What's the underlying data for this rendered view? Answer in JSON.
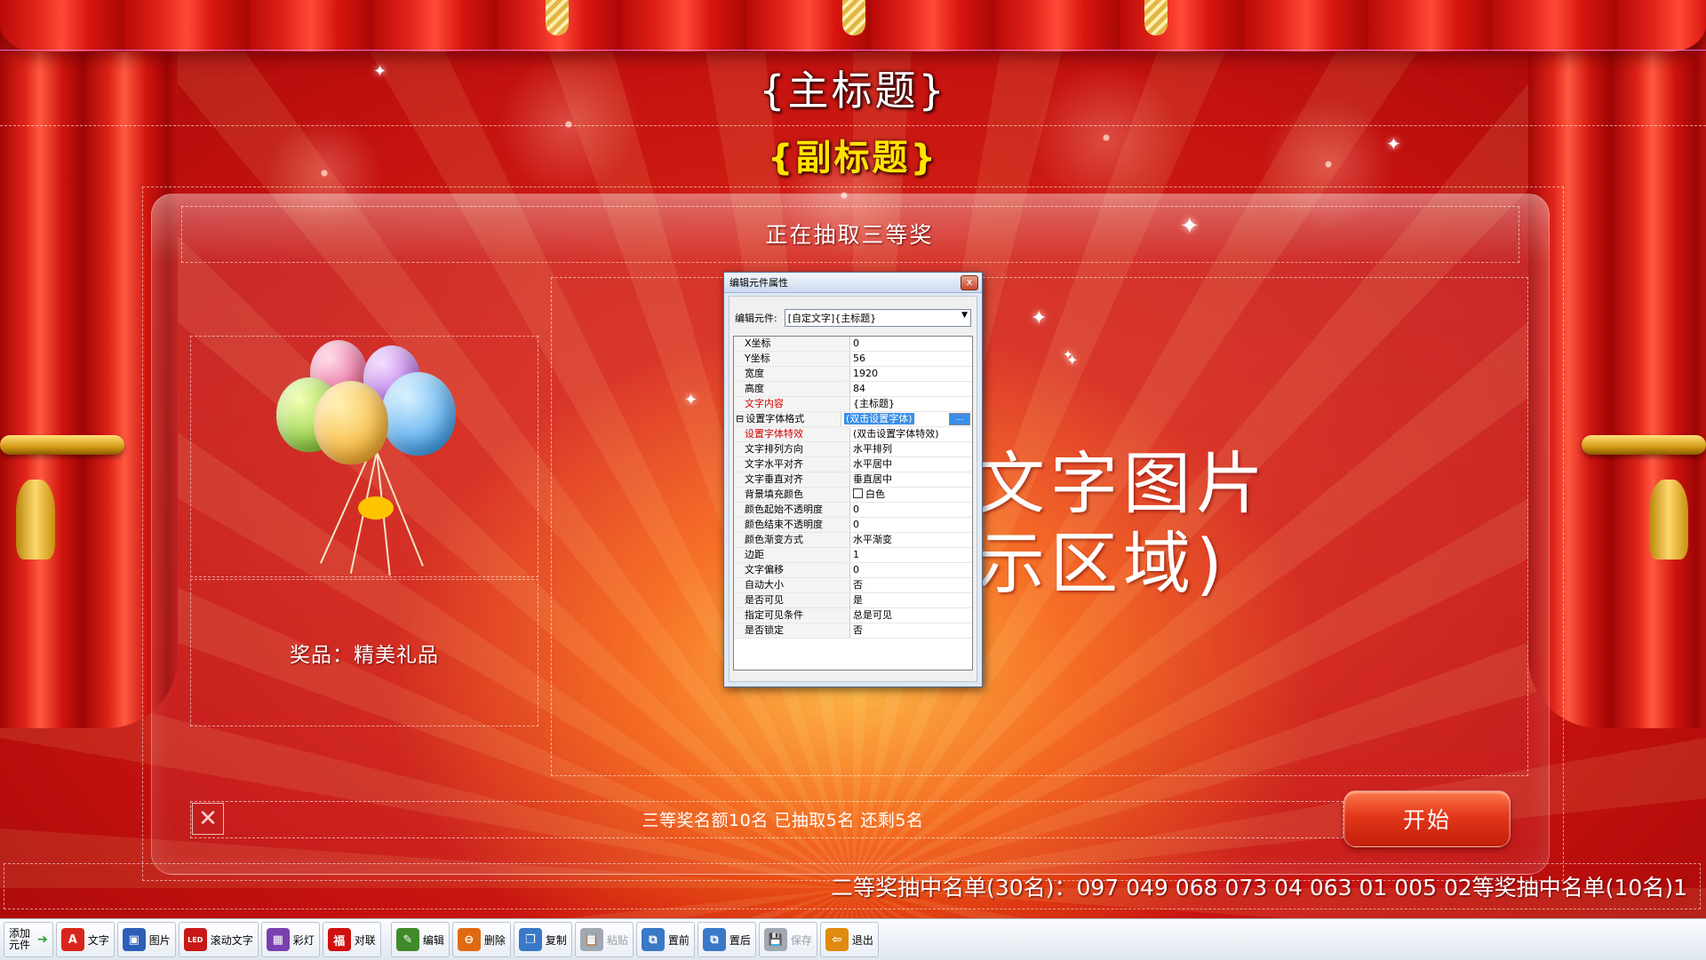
{
  "titles": {
    "main": "{主标题}",
    "sub": "{副标题}"
  },
  "status": {
    "drawing": "正在抽取三等奖"
  },
  "prize": {
    "label": "奖品：精美礼品"
  },
  "display": {
    "line1": "文字图片",
    "line2": "示区域)"
  },
  "progress": {
    "close_glyph": "✕",
    "quota": "三等奖名额10名  已抽取5名  还剩5名"
  },
  "start_button": {
    "label": "开始"
  },
  "winners": {
    "text": "二等奖抽中名单(30名)：097  049  068  073  04  063  01  005  02等奖抽中名单(10名)1"
  },
  "dialog": {
    "title": "编辑元件属性",
    "close_glyph": "x",
    "element_label": "编辑元件:",
    "element_value": "[自定文字]{主标题}",
    "properties": [
      {
        "name": "X坐标",
        "value": "0"
      },
      {
        "name": "Y坐标",
        "value": "56"
      },
      {
        "name": "宽度",
        "value": "1920"
      },
      {
        "name": "高度",
        "value": "84"
      },
      {
        "name": "文字内容",
        "value": "{主标题}",
        "red": true
      },
      {
        "name": "设置字体格式",
        "value": "(双击设置字体)",
        "selected": true,
        "expand": "⊟",
        "ellipsis": "..."
      },
      {
        "name": "设置字体特效",
        "value": "(双击设置字体特效)",
        "red": true
      },
      {
        "name": "文字排列方向",
        "value": "水平排列"
      },
      {
        "name": "文字水平对齐",
        "value": "水平居中"
      },
      {
        "name": "文字垂直对齐",
        "value": "垂直居中"
      },
      {
        "name": "背景填充颜色",
        "value": "白色",
        "checkbox": true
      },
      {
        "name": "颜色起始不透明度",
        "value": "0"
      },
      {
        "name": "颜色结束不透明度",
        "value": "0"
      },
      {
        "name": "颜色渐变方式",
        "value": "水平渐变"
      },
      {
        "name": "边距",
        "value": "1"
      },
      {
        "name": "文字偏移",
        "value": "0"
      },
      {
        "name": "自动大小",
        "value": "否"
      },
      {
        "name": "是否可见",
        "value": "是"
      },
      {
        "name": "指定可见条件",
        "value": "总是可见"
      },
      {
        "name": "是否锁定",
        "value": "否"
      }
    ]
  },
  "toolbar": {
    "add_label": "添加元件",
    "buttons": [
      {
        "label": "文字",
        "icon": "text-icon",
        "glyph": "A",
        "color": "#d9261c"
      },
      {
        "label": "图片",
        "icon": "image-icon",
        "glyph": "▣",
        "color": "#2d5fb8"
      },
      {
        "label": "滚动文字",
        "icon": "led-icon",
        "glyph": "LED",
        "color": "#c81818"
      },
      {
        "label": "彩灯",
        "icon": "lights-icon",
        "glyph": "▦",
        "color": "#7a3fb0"
      },
      {
        "label": "对联",
        "icon": "couplet-icon",
        "glyph": "福",
        "color": "#d01010"
      },
      {
        "label": "编辑",
        "icon": "edit-icon",
        "glyph": "✎",
        "color": "#3f8a2a"
      },
      {
        "label": "删除",
        "icon": "delete-icon",
        "glyph": "⊖",
        "color": "#e06a10"
      },
      {
        "label": "复制",
        "icon": "copy-icon",
        "glyph": "❐",
        "color": "#3a78c8"
      },
      {
        "label": "粘贴",
        "icon": "paste-icon",
        "glyph": "📋",
        "color": "#a0a8b2",
        "disabled": true
      },
      {
        "label": "置前",
        "icon": "bring-front-icon",
        "glyph": "⧉",
        "color": "#3a78c8"
      },
      {
        "label": "置后",
        "icon": "send-back-icon",
        "glyph": "⧉",
        "color": "#3a78c8"
      },
      {
        "label": "保存",
        "icon": "save-icon",
        "glyph": "💾",
        "color": "#a0a8b2",
        "disabled": true
      },
      {
        "label": "退出",
        "icon": "exit-icon",
        "glyph": "⇦",
        "color": "#e08a10"
      }
    ]
  }
}
